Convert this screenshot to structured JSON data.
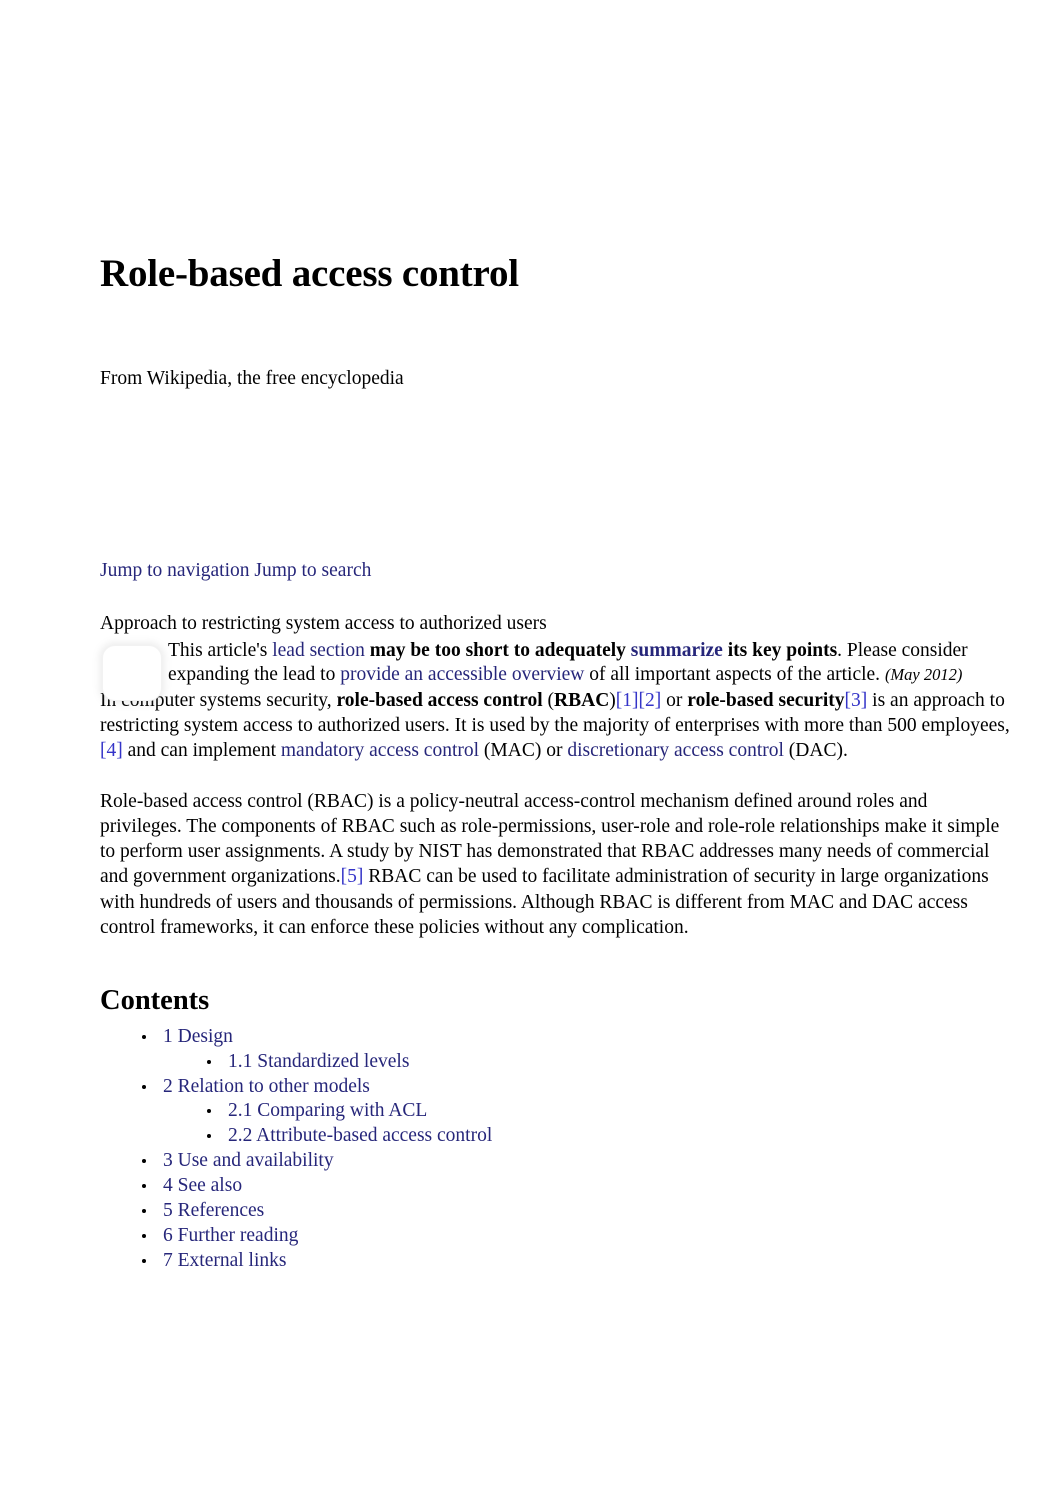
{
  "article": {
    "title": "Role-based access control",
    "from_line": "From Wikipedia, the free encyclopedia",
    "short_description": "Approach to restricting system access to authorized users"
  },
  "jump_links": {
    "navigation": "Jump to navigation",
    "search": "Jump to search",
    "separator": " "
  },
  "hatnote": {
    "icon_name": "article-issue-icon",
    "text_1": "This article's ",
    "link_lead_section": "lead section",
    "text_2": " ",
    "bold_1": "may be too short to adequately ",
    "link_summarize": "summarize",
    "bold_2": " its key points",
    "text_3": ". Please consider expanding the lead to ",
    "link_overview": "provide an accessible overview",
    "text_4": " of all important aspects of the article. ",
    "date": "(May 2012)"
  },
  "lead": {
    "p1_a": "In computer systems security, ",
    "p1_bold1": "role-based access control",
    "p1_b": " (",
    "p1_bold2": "RBAC",
    "p1_c": ")",
    "cite1": "[1]",
    "cite2": "[2]",
    "p1_d": " or ",
    "p1_bold3": "role-based security",
    "cite3": "[3]",
    "p1_e": " is an approach to restricting system access to authorized users. It is used by the majority of enterprises with more than 500 employees,",
    "cite4": "[4]",
    "p1_f": " and can implement ",
    "link_mac": "mandatory access control",
    "p1_g": " (MAC) or ",
    "link_dac": "discretionary access control",
    "p1_h": " (DAC)."
  },
  "paragraph2": {
    "a": "Role-based access control (RBAC) is a policy-neutral access-control mechanism defined around roles and privileges. The components of RBAC such as role-permissions, user-role and role-role relationships make it simple to perform user assignments. A study by NIST has demonstrated that RBAC addresses many needs of commercial and government organizations.",
    "cite5": "[5]",
    "b": " RBAC can be used to facilitate administration of security in large organizations with hundreds of users and thousands of permissions. Although RBAC is different from MAC and DAC access control frameworks, it can enforce these policies without any complication."
  },
  "contents": {
    "heading": "Contents",
    "items": [
      {
        "label": "1 Design",
        "level": 1
      },
      {
        "label": "1.1 Standardized levels",
        "level": 2
      },
      {
        "label": "2 Relation to other models",
        "level": 1
      },
      {
        "label": "2.1 Comparing with ACL",
        "level": 2
      },
      {
        "label": "2.2 Attribute-based access control",
        "level": 2
      },
      {
        "label": "3 Use and availability",
        "level": 1
      },
      {
        "label": "4 See also",
        "level": 1
      },
      {
        "label": "5 References",
        "level": 1
      },
      {
        "label": "6 Further reading",
        "level": 1
      },
      {
        "label": "7 External links",
        "level": 1
      }
    ]
  },
  "colors": {
    "link": "#26267a",
    "citation": "#3434c8",
    "text": "#000000",
    "background": "#ffffff"
  }
}
